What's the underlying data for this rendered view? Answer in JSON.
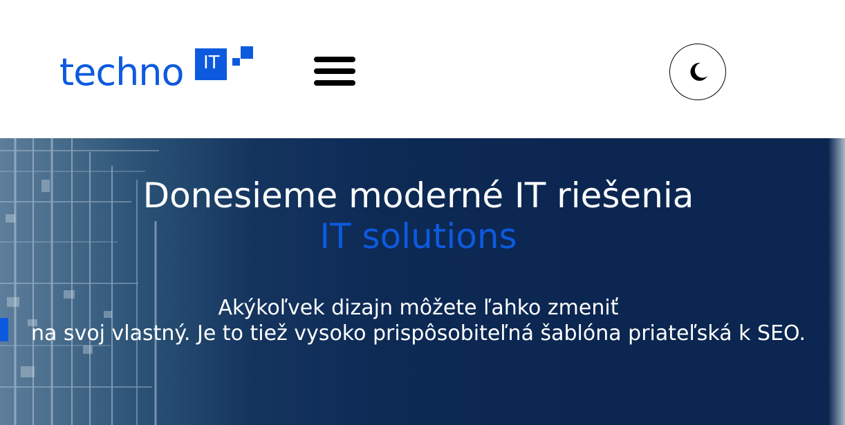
{
  "header": {
    "logo": {
      "text": "techno",
      "badge": "IT",
      "color": "#0d5adf"
    },
    "menu_icon": "hamburger-menu-icon",
    "theme_toggle_icon": "moon-icon"
  },
  "hero": {
    "title": "Donesieme moderné IT riešenia",
    "subtitle": "IT solutions",
    "description_line1": "Akýkoľvek dizajn môžete ľahko zmeniť",
    "description_line2": "na svoj vlastný. Je to tiež vysoko prispôsobiteľná šablóna priateľská k SEO.",
    "colors": {
      "background": "#0b2650",
      "accent": "#0d5adf",
      "text": "#ffffff"
    }
  }
}
